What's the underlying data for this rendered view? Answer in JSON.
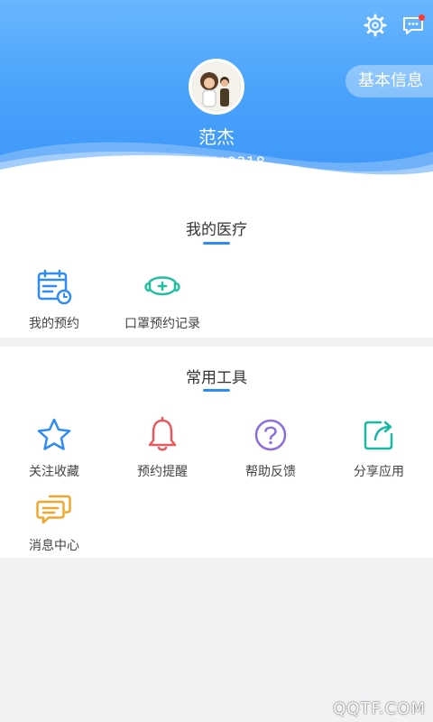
{
  "header": {
    "settings_icon": "gear-icon",
    "message_icon": "message-icon",
    "message_badge_color": "#ff3b30",
    "info_button_label": "基本信息",
    "user": {
      "name": "范杰",
      "phone": "181****0318",
      "avatar_icon": "avatar"
    }
  },
  "medical": {
    "title": "我的医疗",
    "items": [
      {
        "label": "我的预约",
        "icon": "calendar-clock-icon"
      },
      {
        "label": "口罩预约记录",
        "icon": "mask-icon"
      }
    ]
  },
  "tools": {
    "title": "常用工具",
    "items": [
      {
        "label": "关注收藏",
        "icon": "star-icon"
      },
      {
        "label": "预约提醒",
        "icon": "bell-icon"
      },
      {
        "label": "帮助反馈",
        "icon": "help-icon"
      },
      {
        "label": "分享应用",
        "icon": "share-icon"
      },
      {
        "label": "消息中心",
        "icon": "chat-icon"
      }
    ]
  },
  "colors": {
    "accent": "#2f8cf6",
    "header_top": "#6ab6ff",
    "header_bottom": "#3b93f7"
  },
  "watermark": "QQTF.COM"
}
